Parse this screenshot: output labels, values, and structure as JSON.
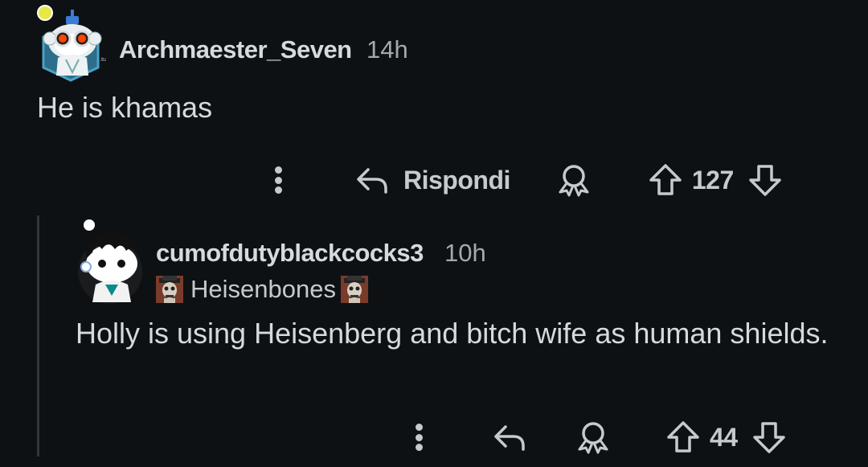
{
  "comments": [
    {
      "username": "Archmaester_Seven",
      "time": "14h",
      "body": "He is khamas",
      "actions": {
        "reply_label": "Rispondi",
        "score": "127"
      }
    },
    {
      "username": "cumofdutyblackcocks3",
      "time": "10h",
      "flair": "Heisenbones",
      "body": "Holly is using Heisenberg and bitch wife as human shields.",
      "actions": {
        "score": "44"
      }
    }
  ],
  "colors": {
    "background": "#0e1113",
    "text": "#d7dadc",
    "muted": "#a6a9ab",
    "thread_line": "#343536"
  },
  "icons": {
    "more": "three-dots-vertical-icon",
    "reply": "reply-arrow-icon",
    "award": "award-icon",
    "upvote": "upvote-arrow-icon",
    "downvote": "downvote-arrow-icon"
  }
}
